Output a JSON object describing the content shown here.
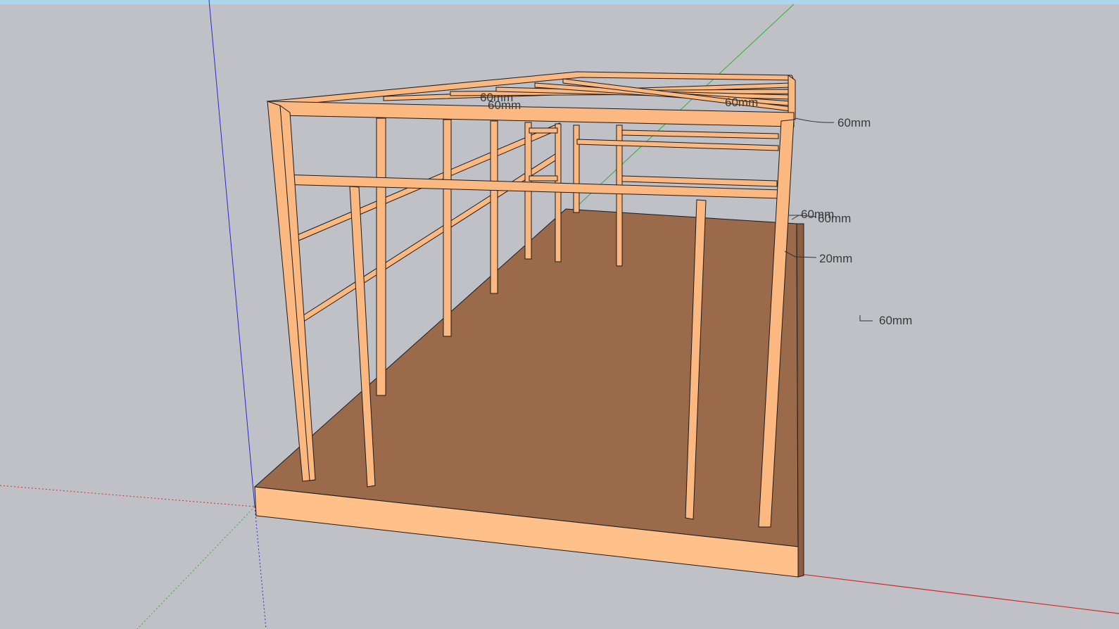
{
  "viewport": {
    "background_color": "#c0c1c6",
    "top_bar_color": "#a9d6ec"
  },
  "colors": {
    "wood_face": "#fbb880",
    "wood_light": "#ffc690",
    "floor_top": "#9a6a4b",
    "floor_edge": "#ffc08a",
    "edge": "#1b1b1b",
    "axis_red": "#d12b2b",
    "axis_green": "#2fb02f",
    "axis_blue": "#2a2ad0"
  },
  "dimensions": [
    {
      "id": "top-mid-a",
      "text": "60mm"
    },
    {
      "id": "top-mid-b",
      "text": "60mm"
    },
    {
      "id": "top-right",
      "text": "60mm"
    },
    {
      "id": "right-top",
      "text": "60mm"
    },
    {
      "id": "right-mid-a",
      "text": "60mm"
    },
    {
      "id": "right-mid-b",
      "text": "60mm"
    },
    {
      "id": "right-low",
      "text": "20mm"
    },
    {
      "id": "right-far",
      "text": "60mm"
    }
  ]
}
